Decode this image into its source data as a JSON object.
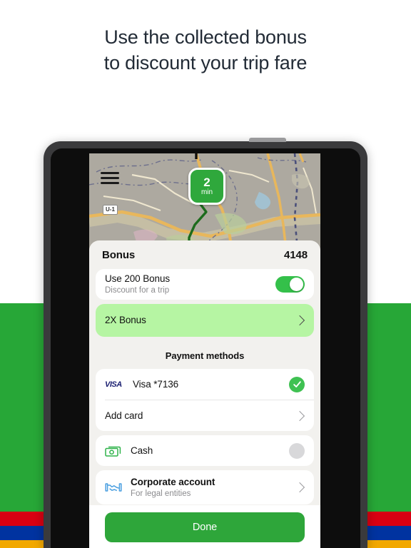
{
  "headline": {
    "line1": "Use the collected bonus",
    "line2": "to discount your trip fare"
  },
  "background": {
    "band_green": "#27a737",
    "band_red": "#d90012",
    "band_blue": "#0033a0",
    "band_orange": "#f2a800"
  },
  "map": {
    "eta_value": "2",
    "eta_unit": "min",
    "road_label": "U-1",
    "menu_icon": "hamburger-icon",
    "route_color": "#1d6b1d",
    "base_color": "#ada9a0"
  },
  "sheet": {
    "title": "Bonus",
    "amount": "4148",
    "bonus_toggle": {
      "title": "Use 200 Bonus",
      "subtitle": "Discount for a trip",
      "state": "on",
      "accent": "#34c04a"
    },
    "bonus_promo": {
      "title": "2X Bonus",
      "background": "#b6f5a3"
    },
    "payment_header": "Payment methods",
    "payment_methods": [
      {
        "icon": "visa-logo-icon",
        "brand": "VISA",
        "title": "Visa *7136",
        "subtitle": "",
        "control": "selected-check",
        "accent": "#3fc152"
      },
      {
        "icon": "",
        "brand": "",
        "title": "Add card",
        "subtitle": "",
        "control": "chevron"
      },
      {
        "icon": "cash-icon",
        "brand": "",
        "title": "Cash",
        "subtitle": "",
        "control": "radio-off"
      },
      {
        "icon": "handshake-icon",
        "brand": "",
        "title": "Corporate account",
        "subtitle": "For legal entities",
        "control": "chevron"
      }
    ],
    "done_label": "Done",
    "done_color": "#2ea63a"
  }
}
